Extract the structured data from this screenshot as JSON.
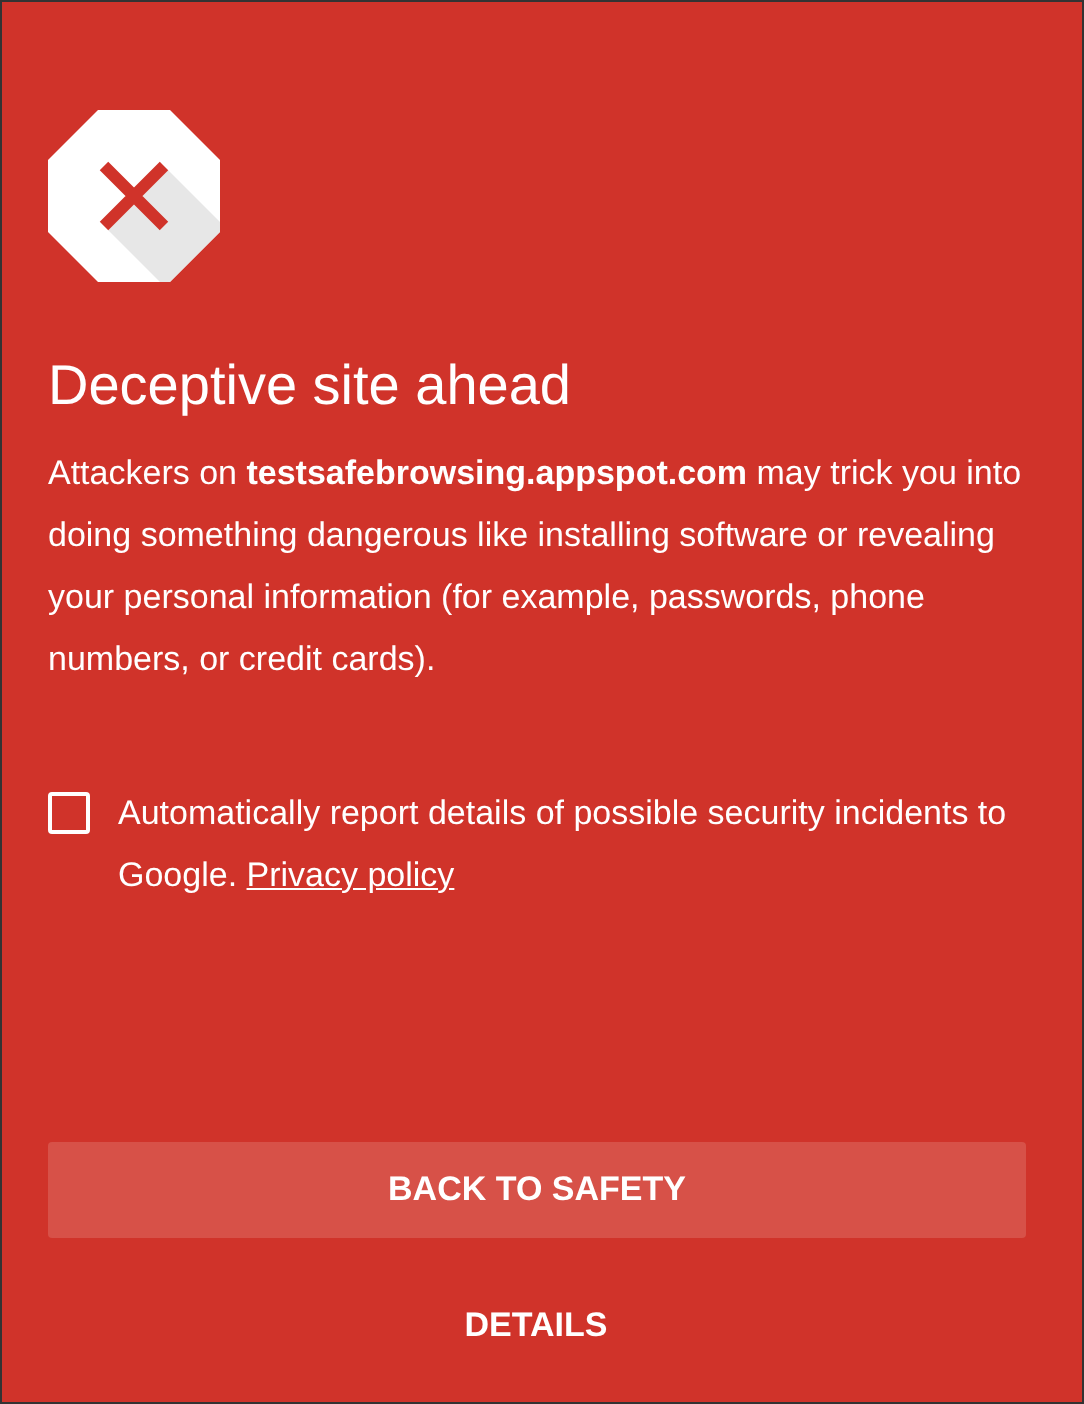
{
  "title": "Deceptive site ahead",
  "message": "Attackers on **testsafebrowsing.appspot.com** may trick you into doing something dangerous like installing software or revealing your personal information (for example, passwords, phone numbers, or credit cards).",
  "report": {
    "checked": false,
    "text": "Automatically report details of possible security incidents to Google.",
    "link": "Privacy policy"
  },
  "primary_button": "BACK TO SAFETY",
  "details_button": "DETAILS"
}
